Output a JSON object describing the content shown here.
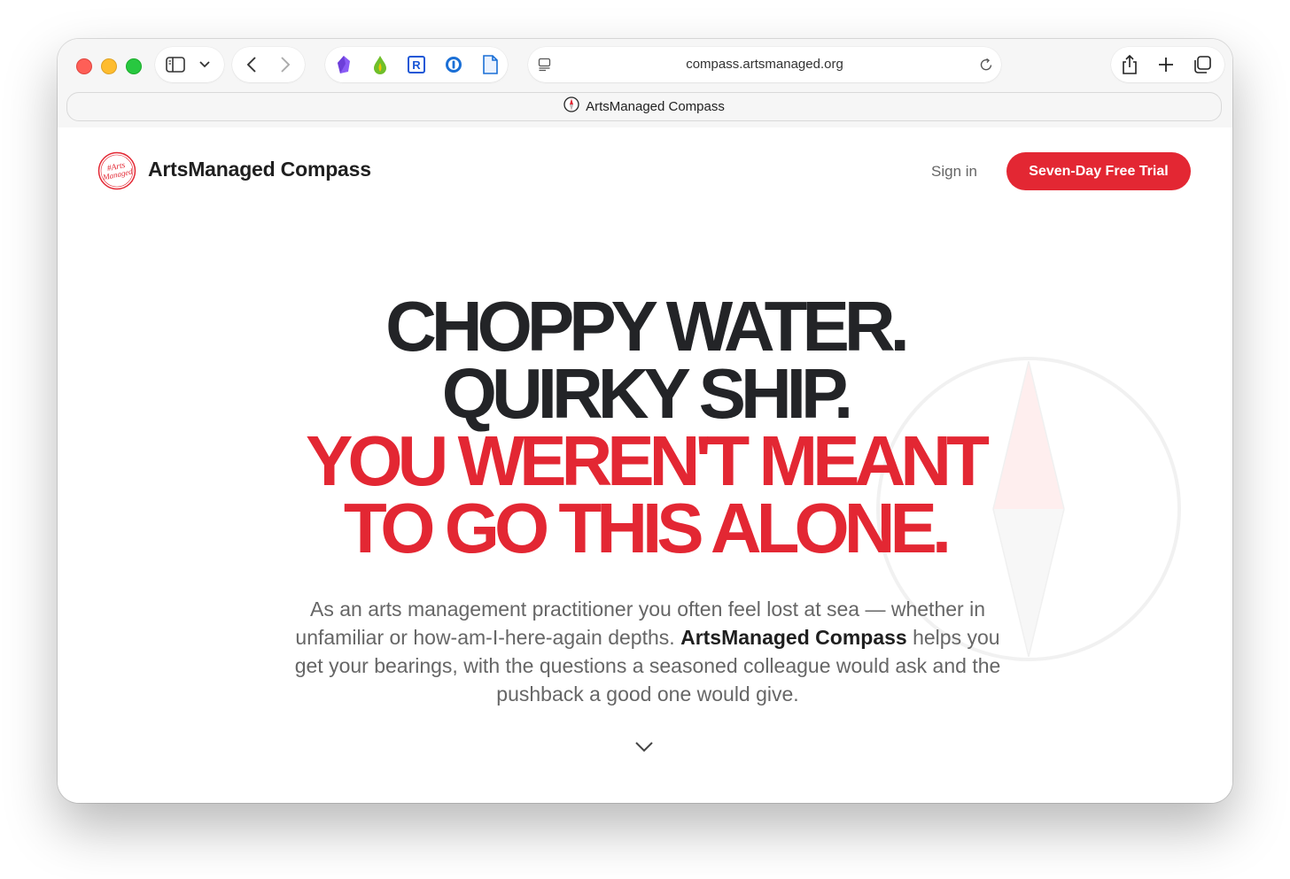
{
  "browser": {
    "url": "compass.artsmanaged.org",
    "tab_title": "ArtsManaged Compass",
    "icons": {
      "sidebar": "sidebar-icon",
      "sidebar_menu": "chevron-down-icon",
      "back": "chevron-left-icon",
      "forward": "chevron-right-icon",
      "extensions": [
        "crystal-extension-icon",
        "green-drop-extension-icon",
        "r-extension-icon",
        "password-manager-icon",
        "document-icon"
      ],
      "reader": "reader-icon",
      "reload": "reload-icon",
      "share": "share-icon",
      "new_tab": "plus-icon",
      "tabs": "tab-overview-icon"
    }
  },
  "header": {
    "logo_text": "#Arts Managed",
    "brand": "ArtsManaged Compass",
    "sign_in": "Sign in",
    "cta": "Seven-Day Free Trial"
  },
  "hero": {
    "line1": "CHOPPY WATER.",
    "line2": "QUIRKY SHIP.",
    "line3": "YOU WEREN'T MEANT",
    "line4": "TO GO THIS ALONE.",
    "lede_part1": "As an arts management practitioner you often feel lost at sea — whether in unfamiliar or how-am-I-here-again depths. ",
    "lede_bold": "ArtsManaged Compass",
    "lede_part2": " helps you get your bearings, with the questions a seasoned colleague would ask and the pushback a good one would give.",
    "scroll_icon": "chevron-down-icon"
  },
  "colors": {
    "accent": "#e32733",
    "dark": "#232427",
    "muted": "#666666"
  }
}
